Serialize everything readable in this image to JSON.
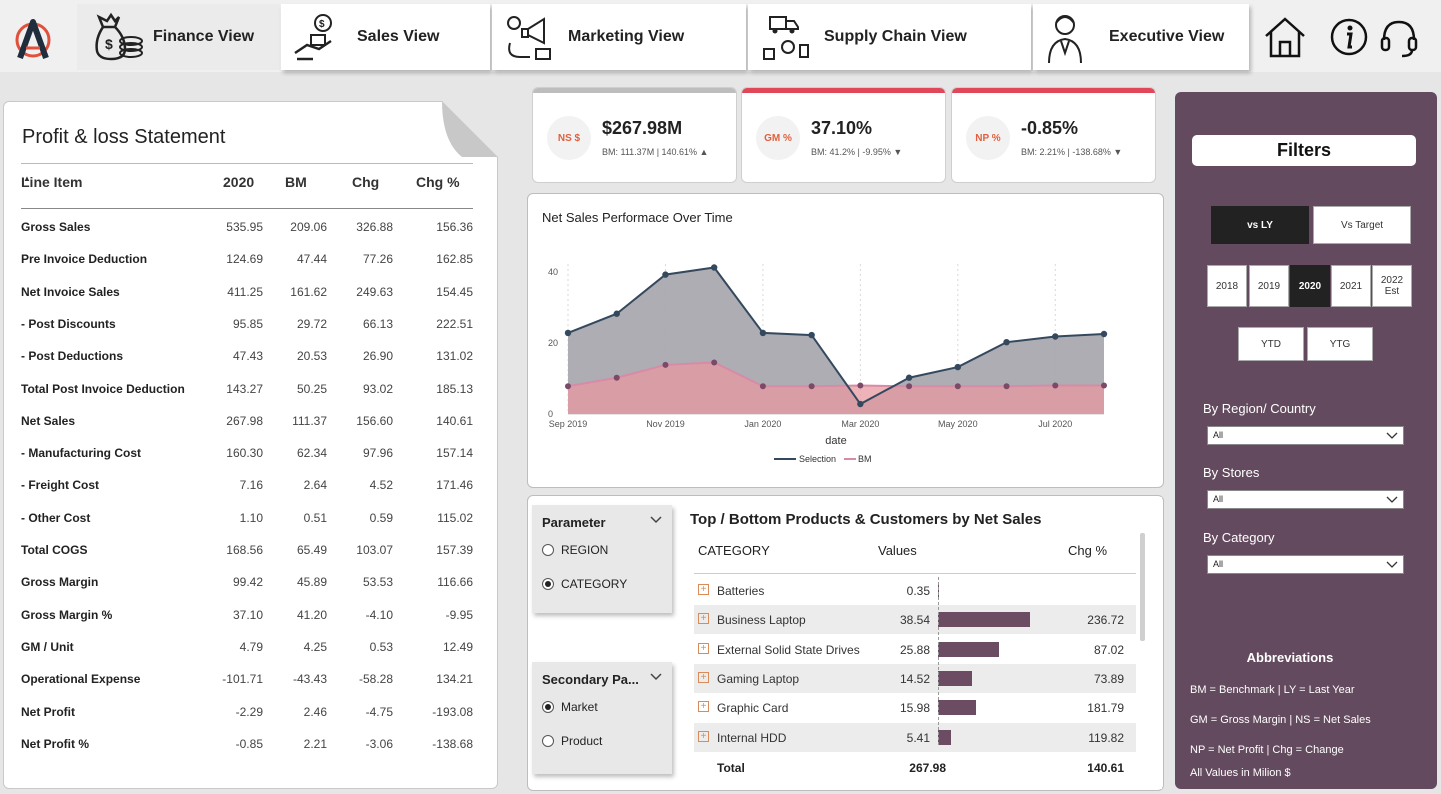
{
  "nav": {
    "tabs": [
      {
        "label": "Finance View",
        "icon": "money-bag-coins-icon",
        "active": true
      },
      {
        "label": "Sales View",
        "icon": "sales-handshake-icon",
        "active": false
      },
      {
        "label": "Marketing View",
        "icon": "marketing-megaphone-icon",
        "active": false
      },
      {
        "label": "Supply Chain View",
        "icon": "supply-chain-truck-icon",
        "active": false
      },
      {
        "label": "Executive View",
        "icon": "executive-person-icon",
        "active": false
      }
    ],
    "icons": [
      "home-icon",
      "info-icon",
      "headset-support-icon"
    ]
  },
  "colors": {
    "accent_red": "#e0485a",
    "filters_bg": "#634a5e",
    "bar": "#6b4c62",
    "selection_line": "#34495e",
    "bm_line": "#d98aa6"
  },
  "pl": {
    "title": "Profit & loss Statement",
    "headers": [
      "Line Item",
      "2020",
      "BM",
      "Chg",
      "Chg %"
    ],
    "rows": [
      [
        "Gross Sales",
        "535.95",
        "209.06",
        "326.88",
        "156.36"
      ],
      [
        "Pre Invoice Deduction",
        "124.69",
        "47.44",
        "77.26",
        "162.85"
      ],
      [
        "Net Invoice Sales",
        "411.25",
        "161.62",
        "249.63",
        "154.45"
      ],
      [
        "- Post Discounts",
        "95.85",
        "29.72",
        "66.13",
        "222.51"
      ],
      [
        "- Post Deductions",
        "47.43",
        "20.53",
        "26.90",
        "131.02"
      ],
      [
        "Total Post Invoice Deduction",
        "143.27",
        "50.25",
        "93.02",
        "185.13"
      ],
      [
        "Net Sales",
        "267.98",
        "111.37",
        "156.60",
        "140.61"
      ],
      [
        "- Manufacturing Cost",
        "160.30",
        "62.34",
        "97.96",
        "157.14"
      ],
      [
        "- Freight Cost",
        "7.16",
        "2.64",
        "4.52",
        "171.46"
      ],
      [
        "- Other Cost",
        "1.10",
        "0.51",
        "0.59",
        "115.02"
      ],
      [
        "Total COGS",
        "168.56",
        "65.49",
        "103.07",
        "157.39"
      ],
      [
        "Gross Margin",
        "99.42",
        "45.89",
        "53.53",
        "116.66"
      ],
      [
        "Gross Margin %",
        "37.10",
        "41.20",
        "-4.10",
        "-9.95"
      ],
      [
        "GM / Unit",
        "4.79",
        "4.25",
        "0.53",
        "12.49"
      ],
      [
        "Operational Expense",
        "-101.71",
        "-43.43",
        "-58.28",
        "134.21"
      ],
      [
        "Net Profit",
        "-2.29",
        "2.46",
        "-4.75",
        "-193.08"
      ],
      [
        "Net Profit %",
        "-0.85",
        "2.21",
        "-3.06",
        "-138.68"
      ]
    ]
  },
  "kpis": [
    {
      "badge": "NS $",
      "value": "$267.98M",
      "sub": "BM: 111.37M | 140.61% ▲",
      "bar_color": "#bdbdbd"
    },
    {
      "badge": "GM %",
      "value": "37.10%",
      "sub": "BM: 41.2% | -9.95% ▼",
      "bar_color": "#e0485a"
    },
    {
      "badge": "NP %",
      "value": "-0.85%",
      "sub": "BM: 2.21% | -138.68% ▼",
      "bar_color": "#e0485a"
    }
  ],
  "chart_data": {
    "type": "area",
    "title": "Net Sales Performace Over Time",
    "xlabel": "date",
    "ylabel": "",
    "ylim": [
      0,
      45
    ],
    "y_ticks": [
      "0",
      "20",
      "40"
    ],
    "x_ticks": [
      "Sep 2019",
      "Nov 2019",
      "Jan 2020",
      "Mar 2020",
      "May 2020",
      "Jul 2020"
    ],
    "x": [
      "2019-09",
      "2019-10",
      "2019-11",
      "2019-12",
      "2020-01",
      "2020-02",
      "2020-03",
      "2020-04",
      "2020-05",
      "2020-06",
      "2020-07",
      "2020-08"
    ],
    "series": [
      {
        "name": "Selection",
        "values": [
          22.8,
          28.2,
          39.2,
          41.2,
          22.8,
          22.2,
          2.8,
          10.2,
          13.2,
          20.2,
          21.8,
          22.5
        ]
      },
      {
        "name": "BM",
        "values": [
          7.8,
          10.2,
          13.8,
          14.5,
          7.8,
          7.8,
          8.0,
          7.8,
          7.8,
          7.8,
          8.0,
          8.0
        ]
      }
    ],
    "legend": "bottom",
    "grid": false
  },
  "params": {
    "parameter": {
      "title": "Parameter",
      "options": [
        {
          "label": "REGION",
          "selected": false
        },
        {
          "label": "CATEGORY",
          "selected": true
        }
      ]
    },
    "secondary": {
      "title": "Secondary Pa...",
      "options": [
        {
          "label": "Market",
          "selected": true
        },
        {
          "label": "Product",
          "selected": false
        }
      ]
    }
  },
  "topbottom": {
    "title": "Top / Bottom Products & Customers by Net Sales",
    "headers": [
      "CATEGORY",
      "Values",
      "Chg %"
    ],
    "rows": [
      {
        "name": "Batteries",
        "value": 0.35,
        "value_label": "0.35",
        "chg": ""
      },
      {
        "name": "Business Laptop",
        "value": 38.54,
        "value_label": "38.54",
        "chg": "236.72"
      },
      {
        "name": "External Solid State Drives",
        "value": 25.88,
        "value_label": "25.88",
        "chg": "87.02"
      },
      {
        "name": "Gaming Laptop",
        "value": 14.52,
        "value_label": "14.52",
        "chg": "73.89"
      },
      {
        "name": "Graphic Card",
        "value": 15.98,
        "value_label": "15.98",
        "chg": "181.79"
      },
      {
        "name": "Internal HDD",
        "value": 5.41,
        "value_label": "5.41",
        "chg": "119.82"
      }
    ],
    "total": {
      "label": "Total",
      "value": "267.98",
      "chg": "140.61"
    }
  },
  "filters": {
    "title": "Filters",
    "compare": [
      {
        "label": "vs LY",
        "selected": true
      },
      {
        "label": "Vs Target",
        "selected": false
      }
    ],
    "years": [
      {
        "label": "2018",
        "selected": false
      },
      {
        "label": "2019",
        "selected": false
      },
      {
        "label": "2020",
        "selected": true
      },
      {
        "label": "2021",
        "selected": false
      },
      {
        "label": "2022 Est",
        "selected": false
      }
    ],
    "periods": [
      {
        "label": "YTD",
        "selected": false
      },
      {
        "label": "YTG",
        "selected": false
      }
    ],
    "dropdowns": [
      {
        "label": "By Region/ Country",
        "value": "All"
      },
      {
        "label": "By Stores",
        "value": "All"
      },
      {
        "label": "By Category",
        "value": "All"
      }
    ],
    "abbr_title": "Abbreviations",
    "abbr": [
      "BM = Benchmark | LY = Last Year",
      "GM = Gross Margin | NS = Net Sales",
      "NP = Net Profit | Chg = Change",
      "All Values in Milion $"
    ]
  }
}
